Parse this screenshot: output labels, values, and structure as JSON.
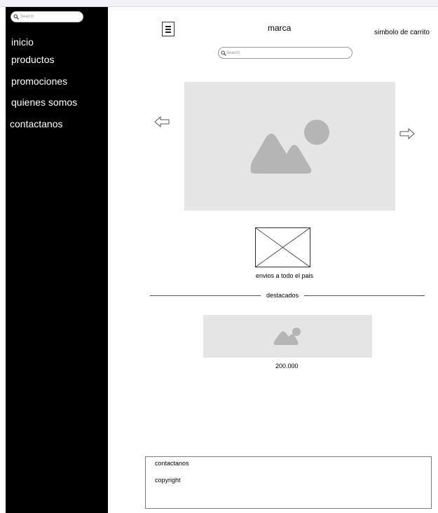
{
  "sidebar": {
    "search_placeholder": "Search",
    "items": [
      {
        "label": "inicio"
      },
      {
        "label": "productos"
      },
      {
        "label": "promociones"
      },
      {
        "label": "quienes somos"
      },
      {
        "label": "contactanos"
      }
    ]
  },
  "header": {
    "brand": "marca",
    "cart": "simbolo de carrito",
    "search_placeholder": "Search",
    "menu_icon": "hamburger-icon"
  },
  "carousel": {
    "prev_icon": "arrow-left-icon",
    "next_icon": "arrow-right-icon",
    "image_icon": "image-placeholder-icon"
  },
  "shipping": {
    "text": "envios a todo el pais"
  },
  "featured": {
    "label": "destacados",
    "products": [
      {
        "price": "200.000"
      }
    ]
  },
  "footer": {
    "contact": "contactanos",
    "copyright": "copyright"
  },
  "colors": {
    "sidebar_bg": "#000000",
    "placeholder_bg": "#e5e5e5",
    "placeholder_shape": "#b5b5b5"
  }
}
